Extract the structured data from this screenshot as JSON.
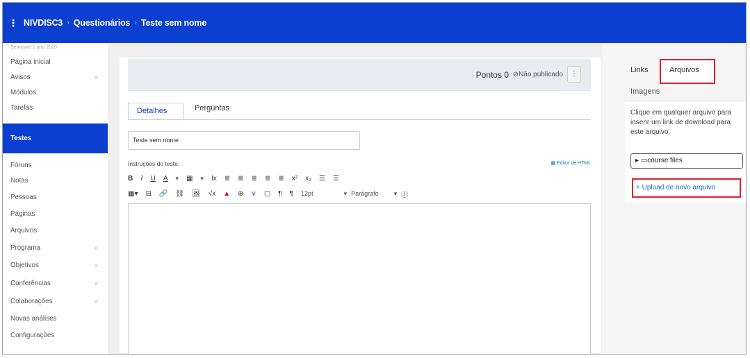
{
  "topbar": {
    "menu_glyph": "⋮",
    "crumbs": [
      "NIVDISC3",
      "Questionários",
      "Teste sem nome"
    ],
    "separator": "›"
  },
  "sidebar": {
    "semester": "Semestre 1 ano 2020",
    "items": [
      {
        "label": "Página inicial",
        "eye": ""
      },
      {
        "label": "Avisos",
        "eye": "ø"
      },
      {
        "label": "Módulos",
        "eye": ""
      },
      {
        "label": "Tarefas",
        "eye": ""
      },
      {
        "label": "Testes",
        "eye": ""
      },
      {
        "label": "Fóruns",
        "eye": ""
      },
      {
        "label": "Notas",
        "eye": ""
      },
      {
        "label": "Pessoas",
        "eye": ""
      },
      {
        "label": "Páginas",
        "eye": ""
      },
      {
        "label": "Arquivos",
        "eye": ""
      },
      {
        "label": "Programa",
        "eye": "ø"
      },
      {
        "label": "Objetivos",
        "eye": "ø"
      },
      {
        "label": "Conferências",
        "eye": "ø"
      },
      {
        "label": "Colaborações",
        "eye": "ø"
      },
      {
        "label": "Novas análises",
        "eye": ""
      },
      {
        "label": "Configurações",
        "eye": ""
      }
    ],
    "active_index": 4
  },
  "header": {
    "pontos_label": "Pontos",
    "pontos_value": "0",
    "publish_icon": "⊘",
    "publish_status": "Não publicado",
    "kebab": "⋮"
  },
  "tabs": {
    "detalhes": "Detalhes",
    "perguntas": "Perguntas"
  },
  "form": {
    "title_value": "Teste sem nome",
    "instructions_label": "Instruções do teste:",
    "html_editor_link": "Editor de HTML"
  },
  "toolbar": {
    "row1": [
      "B",
      "I",
      "U",
      "A",
      "▾",
      "▦",
      "▾",
      "Ix",
      "≣",
      "≣",
      "≣",
      "≣",
      "≣",
      "x²",
      "x₂",
      "☰",
      "☰"
    ],
    "row2": [
      "▦▾",
      "⊟",
      "🔗",
      "⛓",
      "🖼",
      "√x",
      "▲",
      "⊕",
      "∨",
      "▢",
      "¶",
      "¶",
      "12pt",
      "▾",
      "Parágrafo",
      "▾",
      "ⓘ"
    ]
  },
  "right_panel": {
    "tabs": {
      "links": "Links",
      "arquivos": "Arquivos",
      "imagens": "Imagens"
    },
    "help_text": "Clique em qualquer arquivo para inserir um link de download para este arquivo.",
    "course_files": "▸ ▭course files",
    "upload": "+ Upload de novo arquivo"
  },
  "colors": {
    "brand": "#0a3fd0",
    "highlight_border": "#e0202a",
    "link": "#0a6fd0"
  }
}
